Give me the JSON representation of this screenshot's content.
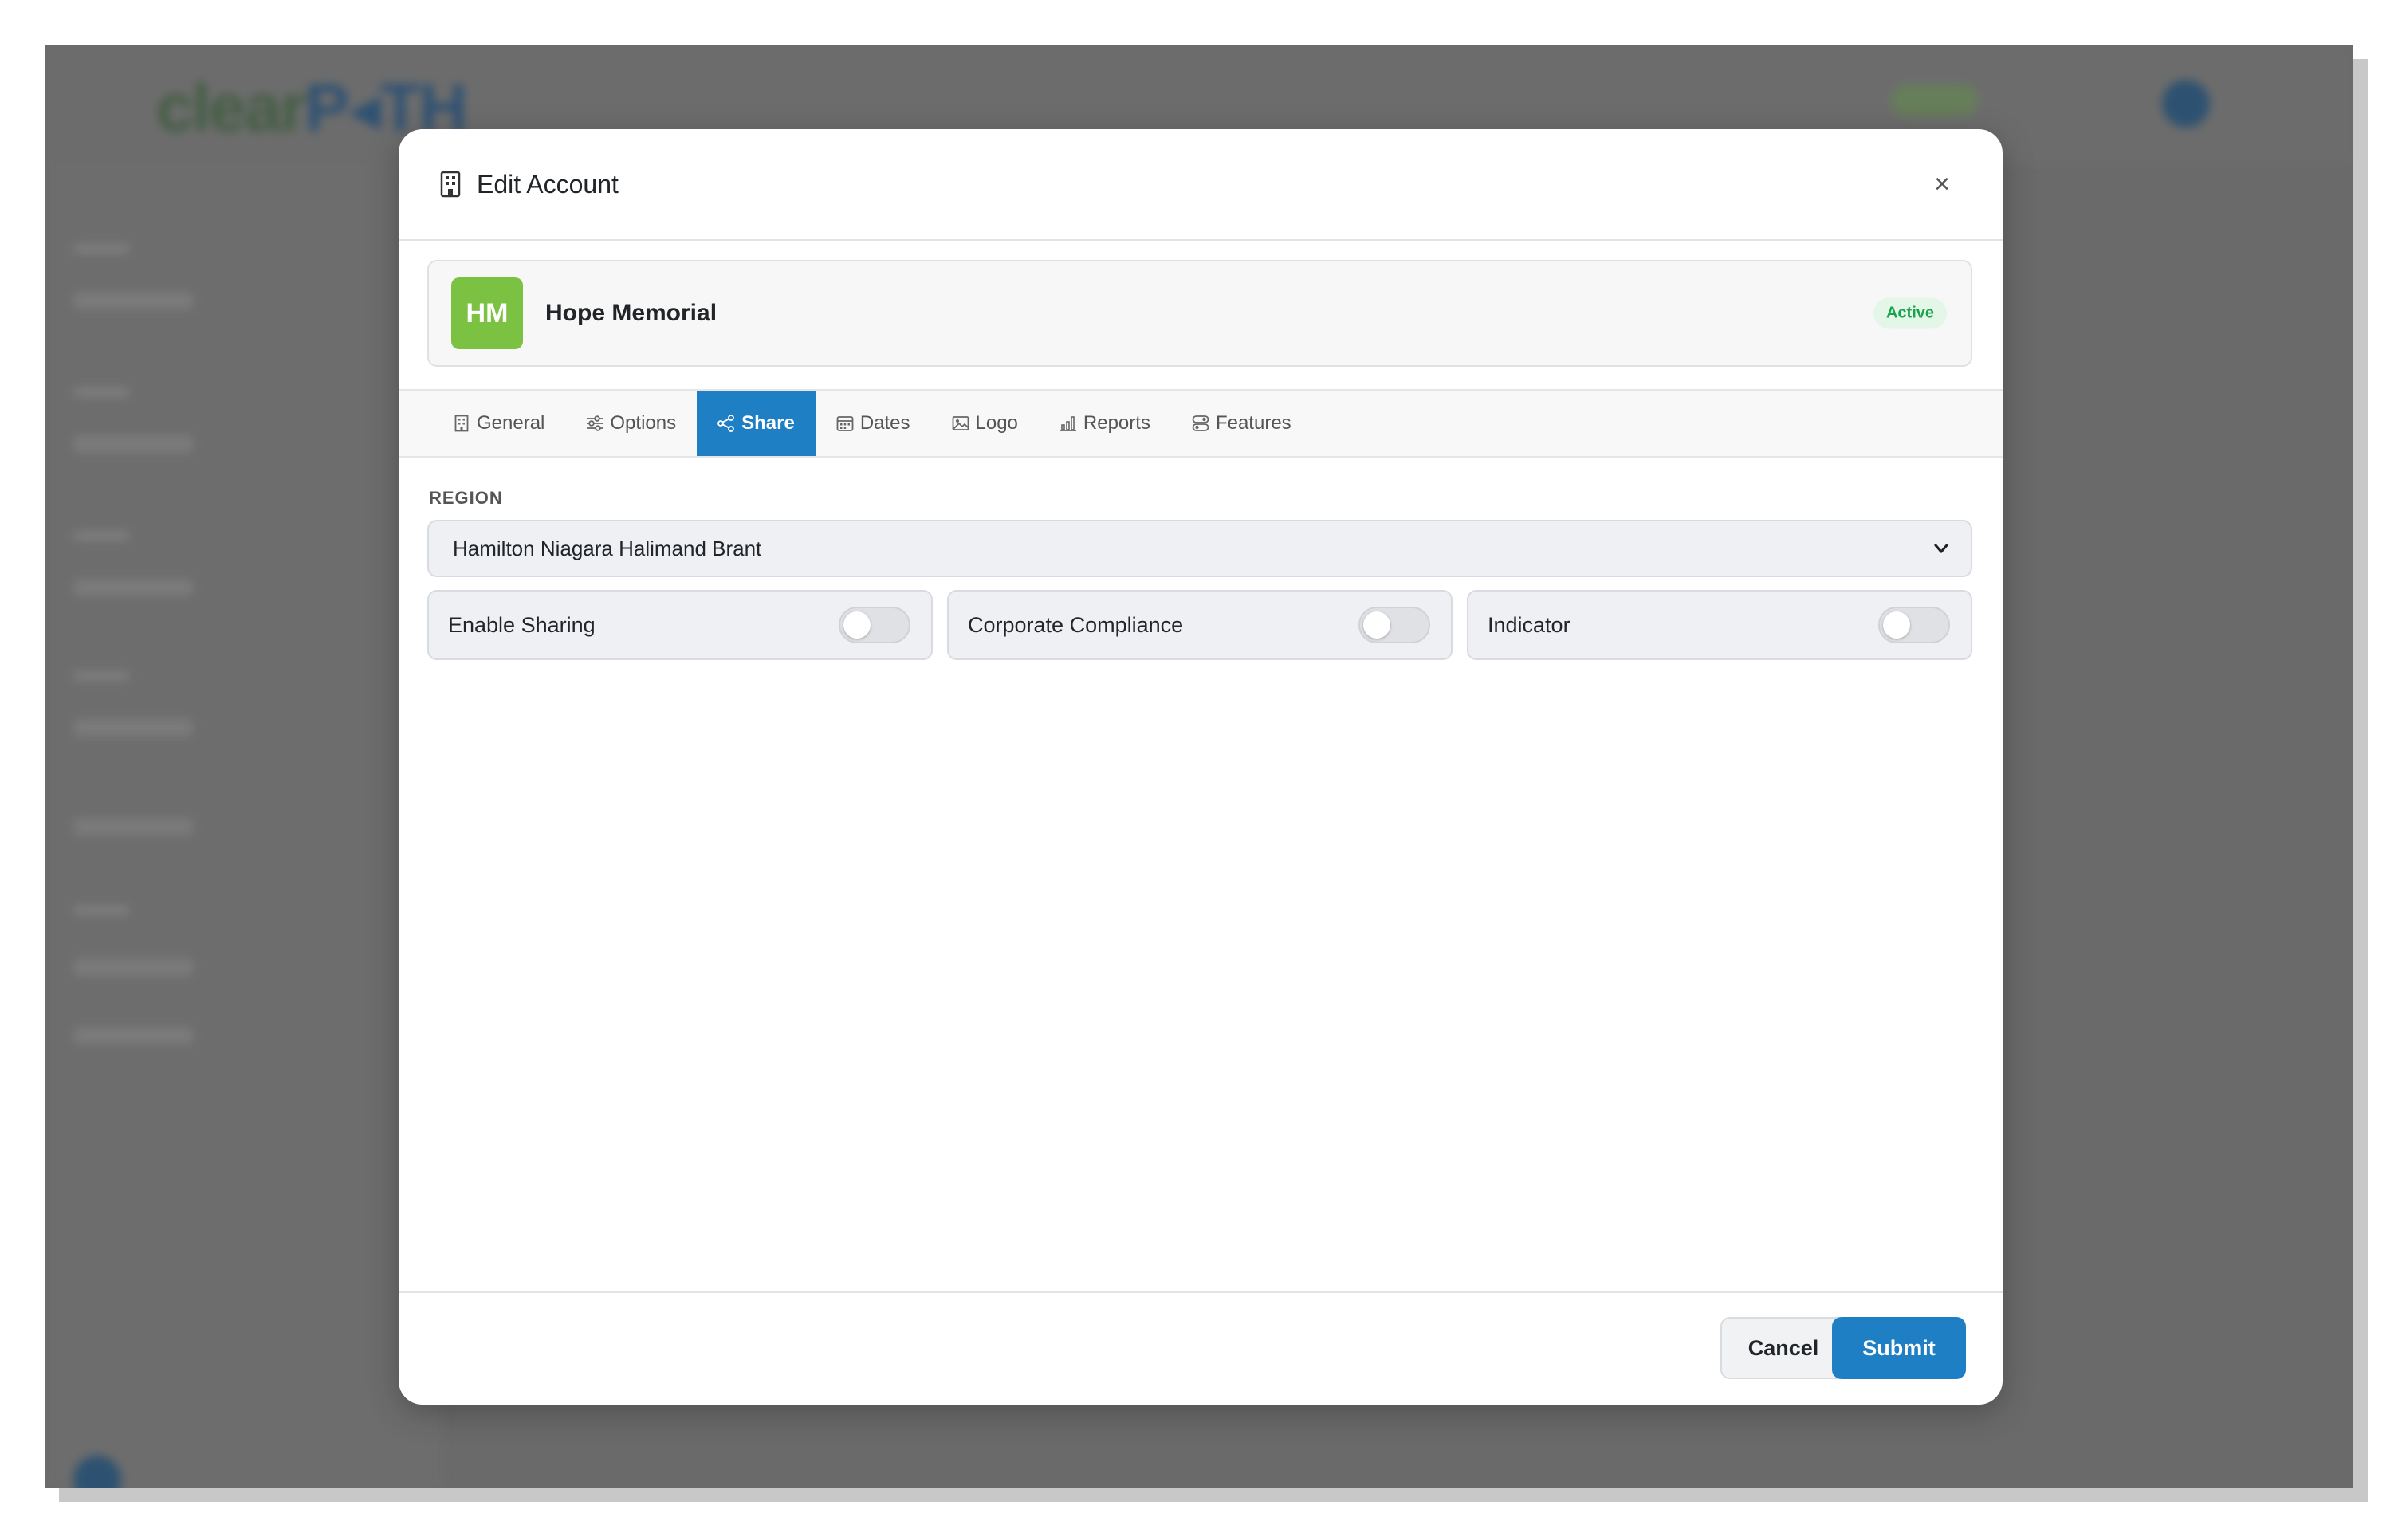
{
  "background": {
    "logo_left": "clear",
    "logo_right": "P◂TH"
  },
  "modal": {
    "title": "Edit Account",
    "close_label": "×",
    "account": {
      "initials": "HM",
      "name": "Hope Memorial",
      "status": "Active",
      "avatar_color": "#7cc242",
      "status_color": "#19a34a"
    },
    "tabs": [
      {
        "label": "General",
        "icon": "building-icon"
      },
      {
        "label": "Options",
        "icon": "sliders-icon"
      },
      {
        "label": "Share",
        "icon": "share-icon",
        "active": true
      },
      {
        "label": "Dates",
        "icon": "calendar-icon"
      },
      {
        "label": "Logo",
        "icon": "image-icon"
      },
      {
        "label": "Reports",
        "icon": "bar-chart-icon"
      },
      {
        "label": "Features",
        "icon": "toggles-icon"
      }
    ],
    "share": {
      "region_label": "REGION",
      "region_value": "Hamilton Niagara Halimand Brant",
      "toggles": [
        {
          "label": "Enable Sharing",
          "on": false
        },
        {
          "label": "Corporate Compliance",
          "on": false
        },
        {
          "label": "Indicator",
          "on": false
        }
      ]
    },
    "footer": {
      "cancel_label": "Cancel",
      "submit_label": "Submit"
    },
    "accent_color": "#1f7fc4"
  }
}
